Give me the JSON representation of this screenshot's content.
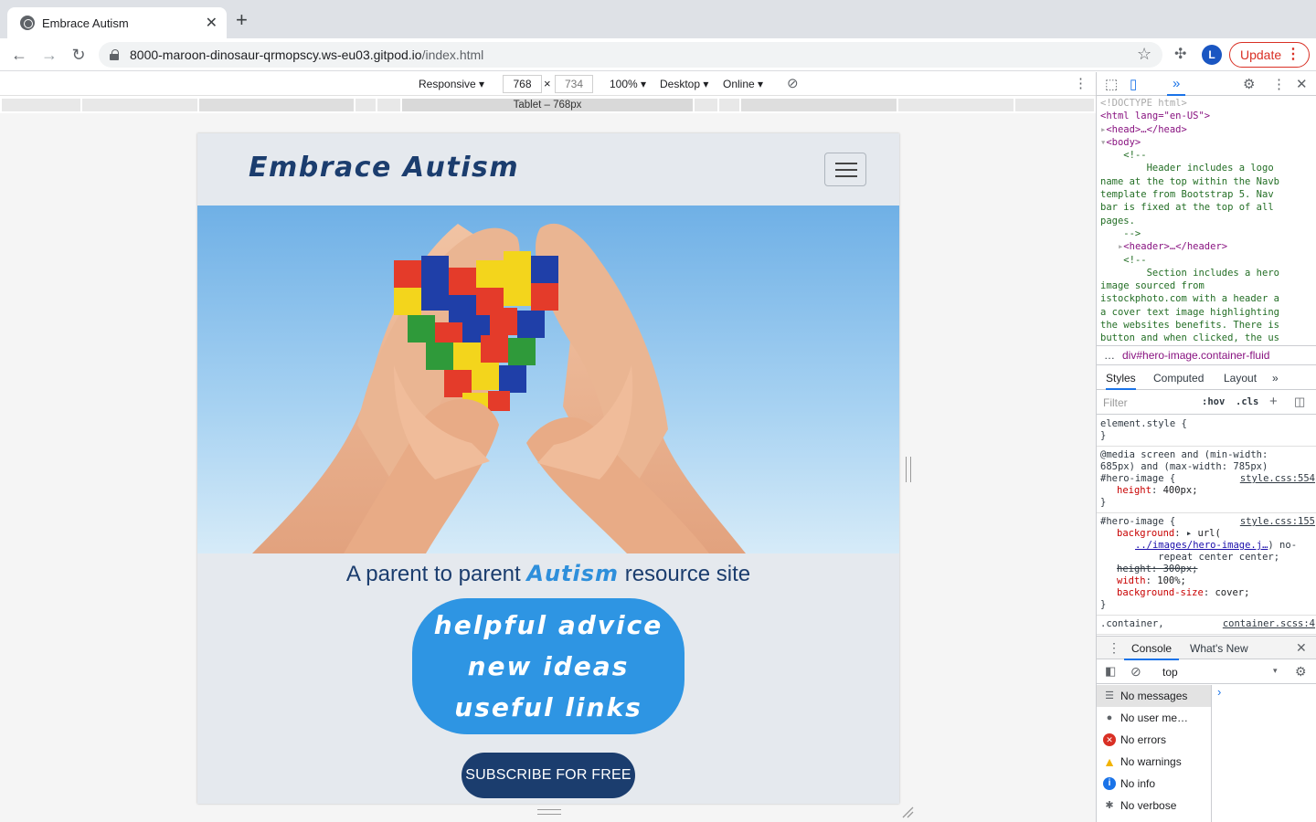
{
  "browser": {
    "tab_title": "Embrace Autism",
    "url_host": "8000-maroon-dinosaur-qrmopscy.ws-eu03.gitpod.io",
    "url_path": "/index.html",
    "avatar_letter": "L",
    "update_label": "Update"
  },
  "device_toolbar": {
    "mode": "Responsive ▾",
    "width": "768",
    "height": "734",
    "zoom": "100% ▾",
    "device_type": "Desktop ▾",
    "network": "Online ▾",
    "media_query_label": "Tablet – 768px"
  },
  "site": {
    "logo": "Embrace Autism",
    "tagline_before": "A parent to parent ",
    "tagline_highlight": "Autism",
    "tagline_after": " resource site",
    "cover_lines": [
      "helpful advice",
      "new ideas",
      "useful links"
    ],
    "subscribe_label": "SUBSCRIBE FOR FREE",
    "colors": {
      "navy": "#1b3d6e",
      "accent_blue": "#2e95e3",
      "background": "#e5e9ee"
    }
  },
  "devtools": {
    "dom": {
      "doctype": "<!DOCTYPE html>",
      "html_open": "<html lang=\"en-US\">",
      "head": "<head>…</head>",
      "body_open": "<body>",
      "comment_open": "<!--",
      "comment1": "        Header includes a logo\nname at the top within the Navb\ntemplate from Bootstrap 5. Nav\nbar is fixed at the top of all\npages.\n    -->",
      "header": "<header>…</header>",
      "comment2": "        Section includes a hero\nimage sourced from\nistockphoto.com with a header a\na cover text image highlighting\nthe websites benefits. There is\nbutton and when clicked, the us"
    },
    "breadcrumb": "div#hero-image.container-fluid",
    "style_tabs": [
      "Styles",
      "Computed",
      "Layout"
    ],
    "filter_placeholder": "Filter",
    "hov": ":hov",
    "cls": ".cls",
    "rules": {
      "element_style": "element.style {",
      "close": "}",
      "media": "@media screen and (min-width:\n685px) and (max-width: 785px)",
      "hero_selector": "#hero-image {",
      "src1": "style.css:554",
      "src2": "style.css:155",
      "height_prop": "height",
      "height_val": "400px;",
      "bg_prop": "background",
      "bg_val_url": "url(",
      "bg_link": "../images/hero-image.j…",
      "bg_tail": ") no-\n    repeat center center;",
      "height_struck": "height: 300px;",
      "width_prop": "width",
      "width_val": "100%;",
      "bgsize_prop": "background-size",
      "bgsize_val": "cover;",
      "container_sel": ".container,",
      "container_src": "container.scss:4"
    },
    "console_tabs": [
      "Console",
      "What's New"
    ],
    "context": "top",
    "sidebar": [
      "No messages",
      "No user me…",
      "No errors",
      "No warnings",
      "No info",
      "No verbose"
    ]
  }
}
